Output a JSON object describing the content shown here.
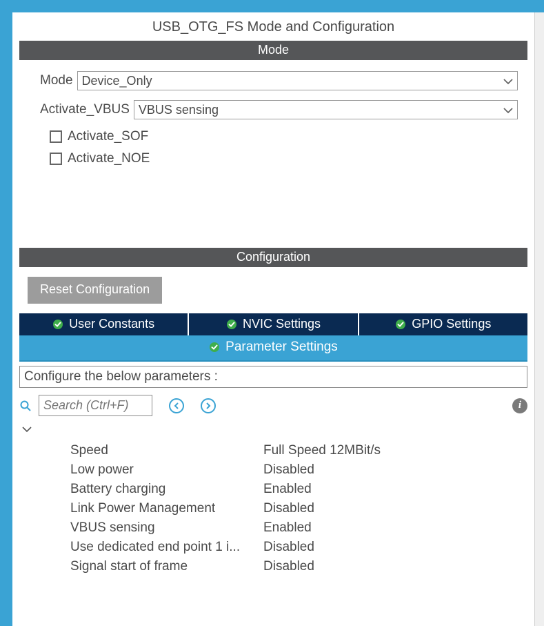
{
  "header": {
    "title": "USB_OTG_FS Mode and Configuration"
  },
  "modeSection": {
    "heading": "Mode",
    "modeLabel": "Mode",
    "modeValue": "Device_Only",
    "vbusLabel": "Activate_VBUS",
    "vbusValue": "VBUS sensing",
    "sofLabel": "Activate_SOF",
    "noeLabel": "Activate_NOE"
  },
  "configSection": {
    "heading": "Configuration",
    "resetLabel": "Reset Configuration",
    "tabs": {
      "userConstants": "User Constants",
      "nvic": "NVIC Settings",
      "gpio": "GPIO Settings",
      "parameter": "Parameter Settings"
    },
    "description": "Configure the below parameters :",
    "searchPlaceholder": "Search (Ctrl+F)",
    "parameters": [
      {
        "name": "Speed",
        "value": "Full Speed 12MBit/s"
      },
      {
        "name": "Low power",
        "value": "Disabled"
      },
      {
        "name": "Battery charging",
        "value": "Enabled"
      },
      {
        "name": "Link Power Management",
        "value": "Disabled"
      },
      {
        "name": "VBUS sensing",
        "value": "Enabled"
      },
      {
        "name": "Use dedicated end point 1 i...",
        "value": "Disabled"
      },
      {
        "name": "Signal start of frame",
        "value": "Disabled"
      }
    ]
  }
}
